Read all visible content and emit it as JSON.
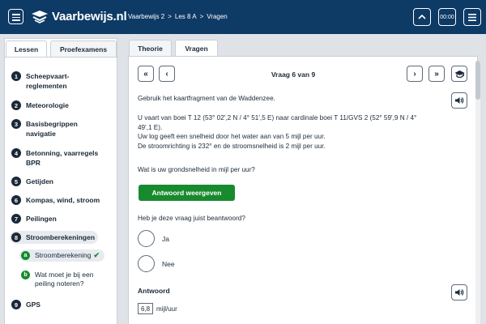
{
  "header": {
    "logo_text": "Vaarbewijs.nl",
    "breadcrumbs": [
      "Vaarbewijs 2",
      "Les 8 A",
      "Vragen"
    ],
    "timer_label": "00:00",
    "colors": {
      "bar": "#0e3a66",
      "accent_green": "#178a2e"
    }
  },
  "sidebar": {
    "tabs": [
      {
        "label": "Lessen",
        "active": true
      },
      {
        "label": "Proefexamens",
        "active": false
      }
    ],
    "lessons": [
      {
        "num": "1",
        "label_lines": [
          "Scheepvaart-",
          "reglementen"
        ]
      },
      {
        "num": "2",
        "label_lines": [
          "Meteorologie"
        ]
      },
      {
        "num": "3",
        "label_lines": [
          "Basisbegrippen",
          "navigatie"
        ]
      },
      {
        "num": "4",
        "label_lines": [
          "Betonning, vaarregels",
          "BPR"
        ]
      },
      {
        "num": "5",
        "label_lines": [
          "Getijden"
        ]
      },
      {
        "num": "6",
        "label_lines": [
          "Kompas, wind, stroom"
        ]
      },
      {
        "num": "7",
        "label_lines": [
          "Peilingen"
        ]
      },
      {
        "num": "8",
        "label_lines": [
          "Stroomberekeningen"
        ],
        "active": true
      },
      {
        "num": "9",
        "label_lines": [
          "GPS"
        ]
      }
    ],
    "sublessons": [
      {
        "letter": "a",
        "label_lines": [
          "Stroomberekening"
        ],
        "done": true,
        "active": true
      },
      {
        "letter": "b",
        "label_lines": [
          "Wat moet je bij een",
          "peiling noteren?"
        ],
        "done": false
      }
    ]
  },
  "main": {
    "tabs": [
      {
        "label": "Theorie",
        "active": false
      },
      {
        "label": "Vragen",
        "active": true
      }
    ],
    "question_counter": "Vraag 6 van 9",
    "intro": "Gebruik het kaartfragment van de Waddenzee.",
    "question_lines": [
      "U vaart van boei T 12 (53° 02',2 N / 4° 51',5 E) naar cardinale boei T 11/GVS 2 (52° 59',9 N / 4°",
      "49',1 E).",
      "Uw log geeft een snelheid door het water aan van 5 mijl per uur.",
      "De stroomrichting is 232° en de stroomsnelheid is 2 mijl per uur."
    ],
    "prompt": "Wat is uw grondsnelheid in mijl per uur?",
    "show_answer_label": "Antwoord weergeven",
    "self_check_question": "Heb je deze vraag juist beantwoord?",
    "options": [
      "Ja",
      "Nee"
    ],
    "answer_heading": "Antwoord",
    "answer_value": "6,8",
    "answer_unit": "mijl/uur"
  }
}
